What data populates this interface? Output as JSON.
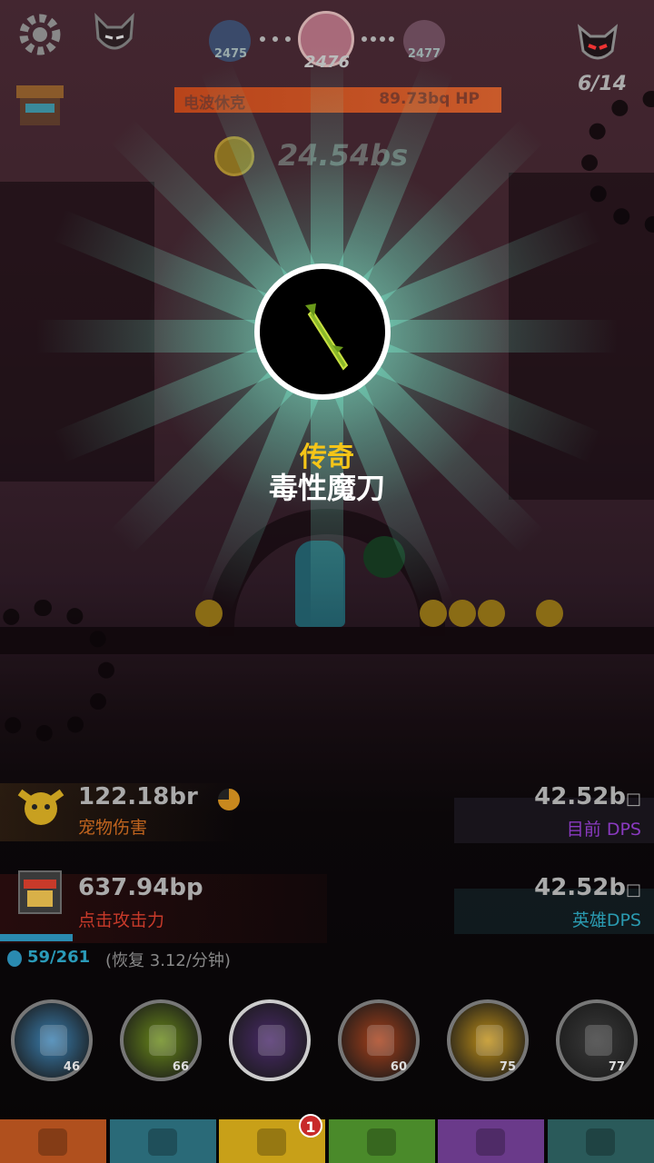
{
  "top": {
    "settings_icon": "gear-icon",
    "boss_icon": "demon-mask-icon",
    "stages": [
      {
        "num": "2475"
      },
      {
        "num": "2476"
      },
      {
        "num": "2477"
      }
    ],
    "boss_count": "6/14",
    "boss_name": "电波休克",
    "boss_hp": "89.73bq HP",
    "hp_fill_pct": 100,
    "timer": "24.54bs"
  },
  "reward": {
    "rarity": "传奇",
    "name": "毒性魔刀",
    "rarity_color": "#f5c518"
  },
  "stats": {
    "pet_damage_value": "122.18br",
    "pet_damage_label": "宠物伤害",
    "tap_damage_value": "637.94bp",
    "tap_damage_label": "点击攻击力",
    "current_dps_value": "42.52b",
    "current_dps_label": "目前 DPS",
    "hero_dps_value": "42.52b",
    "hero_dps_label": "英雄DPS"
  },
  "mana": {
    "value": "59/261",
    "regen": "(恢复 3.12/分钟)"
  },
  "skills": [
    {
      "icon": "angel-icon",
      "level": "46",
      "color": "#3a7fb0"
    },
    {
      "icon": "sword-icon",
      "level": "66",
      "color": "#6a8a1a"
    },
    {
      "icon": "crown-coin-icon",
      "level": "",
      "color": "#4a2a6a"
    },
    {
      "icon": "blade-icon",
      "level": "60",
      "color": "#a8401a"
    },
    {
      "icon": "weapons-icon",
      "level": "75",
      "color": "#c09018"
    },
    {
      "icon": "shadow-icon",
      "level": "77",
      "color": "#3a3a3a"
    }
  ],
  "tabs": [
    {
      "icon": "sword-tab-icon",
      "color": "#b0501e"
    },
    {
      "icon": "helmet-tab-icon",
      "color": "#2a6a78"
    },
    {
      "icon": "armor-tab-icon",
      "color": "#c8a018",
      "badge": "1"
    },
    {
      "icon": "pet-tab-icon",
      "color": "#4a8a2a"
    },
    {
      "icon": "heart-tab-icon",
      "color": "#6a3a8a"
    },
    {
      "icon": "star-tab-icon",
      "color": "#2a5a5a"
    }
  ]
}
